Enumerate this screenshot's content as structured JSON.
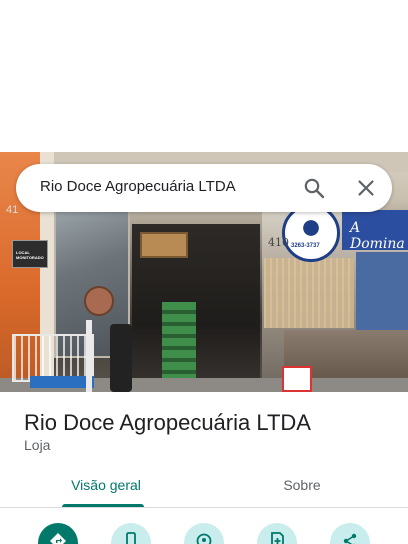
{
  "search": {
    "query": "Rio Doce Agropecuária LTDA",
    "search_icon": "search-icon",
    "close_icon": "close-icon"
  },
  "photo": {
    "plate_text": "LOCAL MONITORADO",
    "number_left": "41",
    "number_right": "410",
    "sign_text": "A Domina",
    "logo_phone": "3263-3737"
  },
  "place": {
    "name": "Rio Doce Agropecuária LTDA",
    "category": "Loja"
  },
  "tabs": [
    {
      "label": "Visão geral",
      "selected": true
    },
    {
      "label": "Sobre",
      "selected": false
    }
  ],
  "actions": [
    {
      "icon": "directions-icon"
    },
    {
      "icon": "phone-icon"
    },
    {
      "icon": "location-icon"
    },
    {
      "icon": "save-icon"
    },
    {
      "icon": "share-icon"
    }
  ],
  "colors": {
    "accent": "#00796b",
    "action_bg": "#c9ecec"
  }
}
